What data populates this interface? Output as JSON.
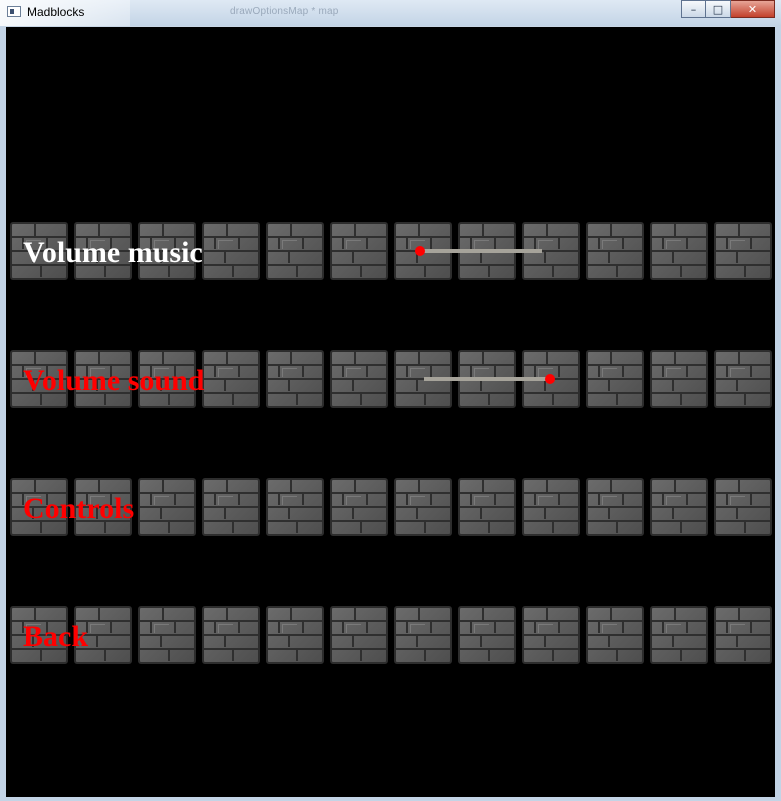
{
  "window": {
    "title": "Madblocks",
    "background_text": "drawOptionsMap * map",
    "minimize": "–",
    "maximize": "□",
    "close": "✕"
  },
  "menu": {
    "items": [
      {
        "label": "Volume music",
        "color": "#ffffff",
        "selected": true,
        "slider": {
          "value": 0.0
        }
      },
      {
        "label": "Volume sound",
        "color": "#ff0000",
        "selected": false,
        "slider": {
          "value": 1.0
        }
      },
      {
        "label": "Controls",
        "color": "#ff0000",
        "selected": false
      },
      {
        "label": "Back",
        "color": "#ff0000",
        "selected": false
      }
    ]
  },
  "colors": {
    "selected_text": "#ffffff",
    "menu_text": "#ff0000",
    "slider_knob": "#ff0000",
    "slider_track": "#a6a39a",
    "canvas": "#000000"
  },
  "icons": [
    "app-icon",
    "minimize-icon",
    "maximize-icon",
    "close-icon",
    "stone-brick-tile"
  ]
}
